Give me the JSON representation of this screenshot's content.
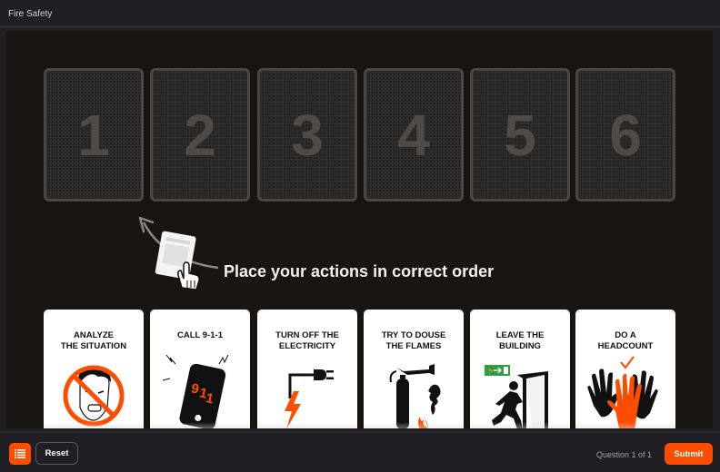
{
  "header": {
    "title": "Fire Safety"
  },
  "slots": [
    {
      "number": "1"
    },
    {
      "number": "2"
    },
    {
      "number": "3"
    },
    {
      "number": "4"
    },
    {
      "number": "5"
    },
    {
      "number": "6"
    }
  ],
  "instruction": {
    "text": "Place your actions in correct order",
    "icon": "drag-card-icon"
  },
  "cards": [
    {
      "label": "ANALYZE\nTHE SITUATION",
      "icon": "no-panic-icon"
    },
    {
      "label": "CALL 9-1-1",
      "icon": "phone-911-icon",
      "phone_text": "911"
    },
    {
      "label": "TURN OFF THE\nELECTRICITY",
      "icon": "plug-lightning-icon"
    },
    {
      "label": "TRY TO DOUSE\nTHE FLAMES",
      "icon": "fire-extinguisher-icon"
    },
    {
      "label": "LEAVE THE\nBUILDING",
      "icon": "emergency-exit-icon"
    },
    {
      "label": "DO A\nHEADCOUNT",
      "icon": "raised-hands-icon"
    }
  ],
  "footer": {
    "menu_icon": "list-icon",
    "reset_label": "Reset",
    "counter": "Question 1 of 1",
    "submit_label": "Submit"
  },
  "colors": {
    "accent": "#ff4d00",
    "background": "#1f1f24",
    "stage": "#181512",
    "slot_border": "#4a4745",
    "exit_sign": "#2ea043"
  }
}
